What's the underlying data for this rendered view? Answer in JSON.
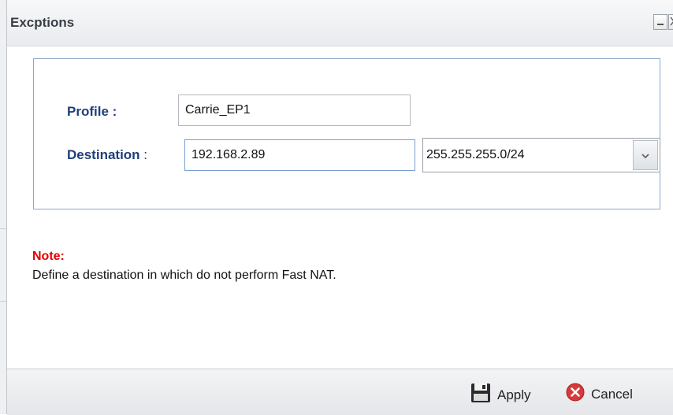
{
  "dialog": {
    "title": "Excptions"
  },
  "form": {
    "profile_label": "Profile :",
    "profile_value": "Carrie_EP1",
    "destination_label": "Destination",
    "destination_colon": ":",
    "destination_ip": "192.168.2.89",
    "destination_mask": "255.255.255.0/24"
  },
  "note": {
    "title": "Note:",
    "text": "Define a destination in which do not perform Fast NAT."
  },
  "footer": {
    "apply_label": "Apply",
    "cancel_label": "Cancel"
  },
  "colors": {
    "label_blue": "#1f3f7a",
    "note_red": "#e00000",
    "cancel_red": "#d63a3a"
  },
  "icons": {
    "minimize": "minimize-icon",
    "close": "close-icon",
    "apply": "save-icon",
    "cancel": "cancel-icon",
    "dropdown": "chevron-down-icon"
  }
}
